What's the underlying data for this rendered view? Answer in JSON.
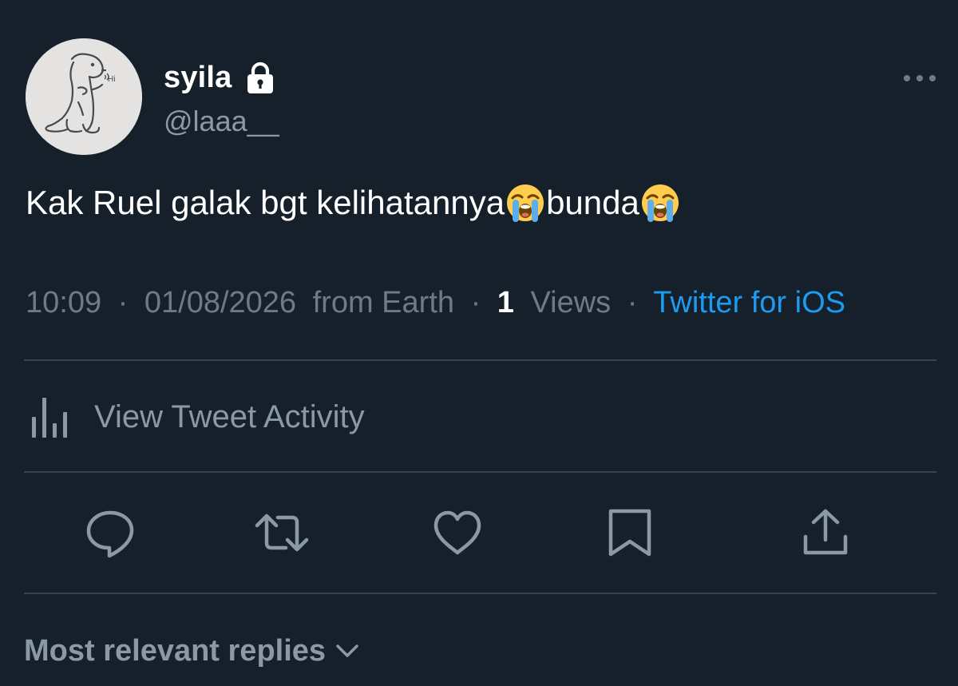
{
  "author": {
    "display_name": "syila",
    "handle": "@laaa__",
    "avatar": "dinosaur-doodle-avatar",
    "avatar_text": "Hi"
  },
  "tweet": {
    "text_part1": "Kak Ruel galak bgt kelihatannya",
    "text_part2": " bunda",
    "emoji": "loudly-crying-face"
  },
  "meta": {
    "time": "10:09",
    "date": "01/08/2026",
    "location": "from Earth",
    "separator": "·",
    "views_count": "1",
    "views_label": "Views",
    "source": "Twitter for iOS"
  },
  "activity": {
    "label": "View Tweet Activity",
    "icon": "bar-chart-icon"
  },
  "actions": [
    "reply-icon",
    "retweet-icon",
    "like-icon",
    "bookmark-icon",
    "share-icon"
  ],
  "replies": {
    "sort_label": "Most relevant replies",
    "icon": "chevron-down-icon"
  },
  "colors": {
    "background": "#15202b",
    "primary_text": "#ffffff",
    "secondary_text": "#8b98a5",
    "muted_text": "#6e7b87",
    "accent": "#1d9bf0",
    "divider": "#38444d"
  }
}
